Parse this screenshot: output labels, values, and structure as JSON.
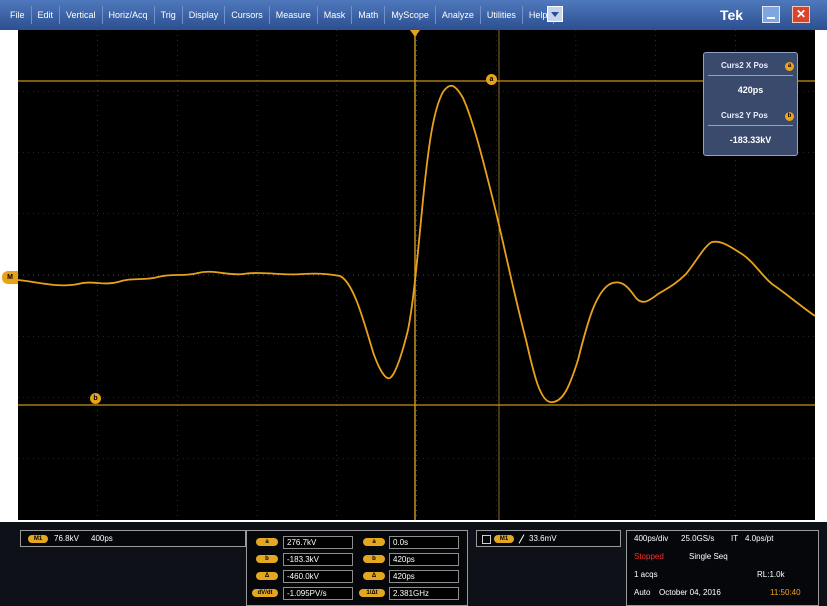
{
  "menu": {
    "items": [
      "File",
      "Edit",
      "Vertical",
      "Horiz/Acq",
      "Trig",
      "Display",
      "Cursors",
      "Measure",
      "Mask",
      "Math",
      "MyScope",
      "Analyze",
      "Utilities",
      "Help"
    ],
    "brand": "Tek",
    "close_glyph": "✕"
  },
  "icons": {
    "menu_dropdown": "chevron-down-icon",
    "minimize": "minimize-icon",
    "close": "close-icon",
    "cursor_a": "cursor-a-marker-icon",
    "cursor_b": "cursor-b-marker-icon",
    "channel_marker": "channel-marker-icon",
    "trigger_slope": "rising-edge-icon"
  },
  "colors": {
    "trace": "#e8a21a",
    "cursor": "#c8931b",
    "grid": "#4a4a4a",
    "panel": "#3a4a6c",
    "stopped": "#ff2c2c",
    "time": "#f3a21b",
    "menubar": "#2c4f90"
  },
  "readout": {
    "x_label": "Curs2 X Pos",
    "x_value": "420ps",
    "y_label": "Curs2 Y Pos",
    "y_value": "-183.33kV",
    "badge_a": "a",
    "badge_b": "b"
  },
  "markers": {
    "channel": "M",
    "cursor_a": "a",
    "cursor_b": "b"
  },
  "status": {
    "channel": {
      "badge": "M1",
      "scale": "76.8kV",
      "time": "400ps"
    },
    "cursors": [
      {
        "badge": "a",
        "value": "276.7kV",
        "badge2": "a",
        "value2": "0.0s"
      },
      {
        "badge": "b",
        "value": "-183.3kV",
        "badge2": "b",
        "value2": "420ps"
      },
      {
        "badge": "Δ",
        "value": "-460.0kV",
        "badge2": "Δ",
        "value2": "420ps"
      },
      {
        "badge": "dV/dt",
        "value": "-1.095PV/s",
        "badge2": "1/Δt",
        "value2": "2.381GHz"
      }
    ],
    "trigger": {
      "badge": "M1",
      "level": "33.6mV"
    },
    "acq": {
      "horiz": "400ps/div",
      "rate": "25.0GS/s",
      "it": "IT",
      "res": "4.0ps/pt",
      "state": "Stopped",
      "mode": "Single Seq",
      "acqs": "1 acqs",
      "rl": "RL:1.0k",
      "trig_mode": "Auto",
      "date": "October 04, 2016",
      "time": "11:50:40"
    }
  }
}
